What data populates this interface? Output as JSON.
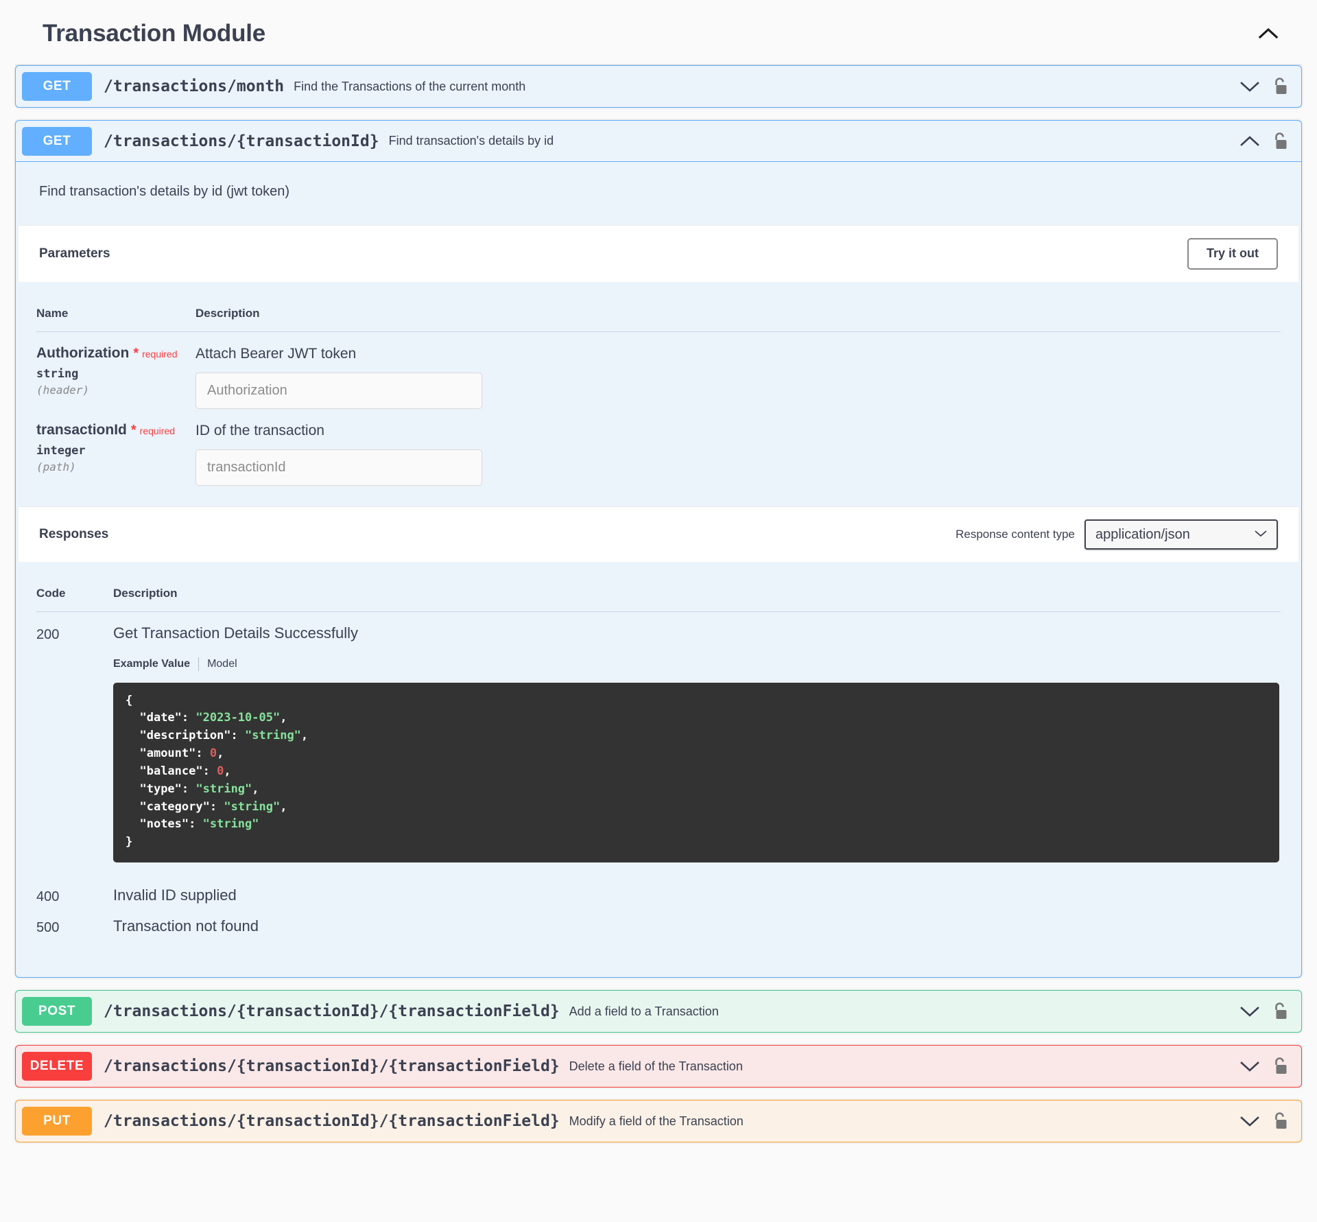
{
  "tag": {
    "title": "Transaction Module",
    "toggle_icon": "chevron-up-icon"
  },
  "operations": [
    {
      "id": "get-transactions-month",
      "method": "GET",
      "method_class": "get",
      "path": "/transactions/month",
      "summary": "Find the Transactions of the current month",
      "expanded": false,
      "chevron_icon": "chevron-down-icon",
      "lock_icon": "unlocked-padlock-icon"
    },
    {
      "id": "get-transaction-by-id",
      "method": "GET",
      "method_class": "get",
      "path": "/transactions/{transactionId}",
      "summary": "Find transaction's details by id",
      "expanded": true,
      "chevron_icon": "chevron-up-icon",
      "lock_icon": "unlocked-padlock-icon",
      "description": "Find transaction's details by id (jwt token)"
    },
    {
      "id": "post-transaction-field",
      "method": "POST",
      "method_class": "post",
      "path": "/transactions/{transactionId}/{transactionField}",
      "summary": "Add a field to a Transaction",
      "expanded": false,
      "chevron_icon": "chevron-down-icon",
      "lock_icon": "unlocked-padlock-icon"
    },
    {
      "id": "delete-transaction-field",
      "method": "DELETE",
      "method_class": "delete",
      "path": "/transactions/{transactionId}/{transactionField}",
      "summary": "Delete a field of the Transaction",
      "expanded": false,
      "chevron_icon": "chevron-down-icon",
      "lock_icon": "unlocked-padlock-icon"
    },
    {
      "id": "put-transaction-field",
      "method": "PUT",
      "method_class": "put",
      "path": "/transactions/{transactionId}/{transactionField}",
      "summary": "Modify a field of the Transaction",
      "expanded": false,
      "chevron_icon": "chevron-down-icon",
      "lock_icon": "unlocked-padlock-icon"
    }
  ],
  "parameters_section": {
    "heading": "Parameters",
    "try_it_out_label": "Try it out",
    "columns": {
      "name": "Name",
      "description": "Description"
    },
    "rows": [
      {
        "name": "Authorization",
        "required_star": "*",
        "required_label": "required",
        "type": "string",
        "in": "(header)",
        "description": "Attach Bearer JWT token",
        "input_placeholder": "Authorization",
        "input_value": ""
      },
      {
        "name": "transactionId",
        "required_star": "*",
        "required_label": "required",
        "type": "integer",
        "in": "(path)",
        "description": "ID of the transaction",
        "input_placeholder": "transactionId",
        "input_value": ""
      }
    ]
  },
  "responses_section": {
    "heading": "Responses",
    "content_type_label": "Response content type",
    "content_type_value": "application/json",
    "content_type_options": [
      "application/json"
    ],
    "columns": {
      "code": "Code",
      "description": "Description"
    },
    "rows": [
      {
        "code": "200",
        "description": "Get Transaction Details Successfully",
        "tabs": {
          "example": "Example Value",
          "model": "Model"
        },
        "example_lines": [
          {
            "indent": 0,
            "parts": [
              {
                "t": "punc",
                "v": "{"
              }
            ]
          },
          {
            "indent": 1,
            "parts": [
              {
                "t": "key",
                "v": "\"date\""
              },
              {
                "t": "punc",
                "v": ": "
              },
              {
                "t": "str",
                "v": "\"2023-10-05\""
              },
              {
                "t": "punc",
                "v": ","
              }
            ]
          },
          {
            "indent": 1,
            "parts": [
              {
                "t": "key",
                "v": "\"description\""
              },
              {
                "t": "punc",
                "v": ": "
              },
              {
                "t": "str",
                "v": "\"string\""
              },
              {
                "t": "punc",
                "v": ","
              }
            ]
          },
          {
            "indent": 1,
            "parts": [
              {
                "t": "key",
                "v": "\"amount\""
              },
              {
                "t": "punc",
                "v": ": "
              },
              {
                "t": "num",
                "v": "0"
              },
              {
                "t": "punc",
                "v": ","
              }
            ]
          },
          {
            "indent": 1,
            "parts": [
              {
                "t": "key",
                "v": "\"balance\""
              },
              {
                "t": "punc",
                "v": ": "
              },
              {
                "t": "num",
                "v": "0"
              },
              {
                "t": "punc",
                "v": ","
              }
            ]
          },
          {
            "indent": 1,
            "parts": [
              {
                "t": "key",
                "v": "\"type\""
              },
              {
                "t": "punc",
                "v": ": "
              },
              {
                "t": "str",
                "v": "\"string\""
              },
              {
                "t": "punc",
                "v": ","
              }
            ]
          },
          {
            "indent": 1,
            "parts": [
              {
                "t": "key",
                "v": "\"category\""
              },
              {
                "t": "punc",
                "v": ": "
              },
              {
                "t": "str",
                "v": "\"string\""
              },
              {
                "t": "punc",
                "v": ","
              }
            ]
          },
          {
            "indent": 1,
            "parts": [
              {
                "t": "key",
                "v": "\"notes\""
              },
              {
                "t": "punc",
                "v": ": "
              },
              {
                "t": "str",
                "v": "\"string\""
              }
            ]
          },
          {
            "indent": 0,
            "parts": [
              {
                "t": "punc",
                "v": "}"
              }
            ]
          }
        ]
      },
      {
        "code": "400",
        "description": "Invalid ID supplied"
      },
      {
        "code": "500",
        "description": "Transaction not found"
      }
    ]
  },
  "colors": {
    "get": "#61affe",
    "post": "#49cc90",
    "delete": "#f93e3e",
    "put": "#fca130",
    "required": "#f93e3e",
    "text": "#3b4151",
    "code_bg": "#333333",
    "string_token": "#86e29b",
    "number_token": "#db5f5f"
  }
}
